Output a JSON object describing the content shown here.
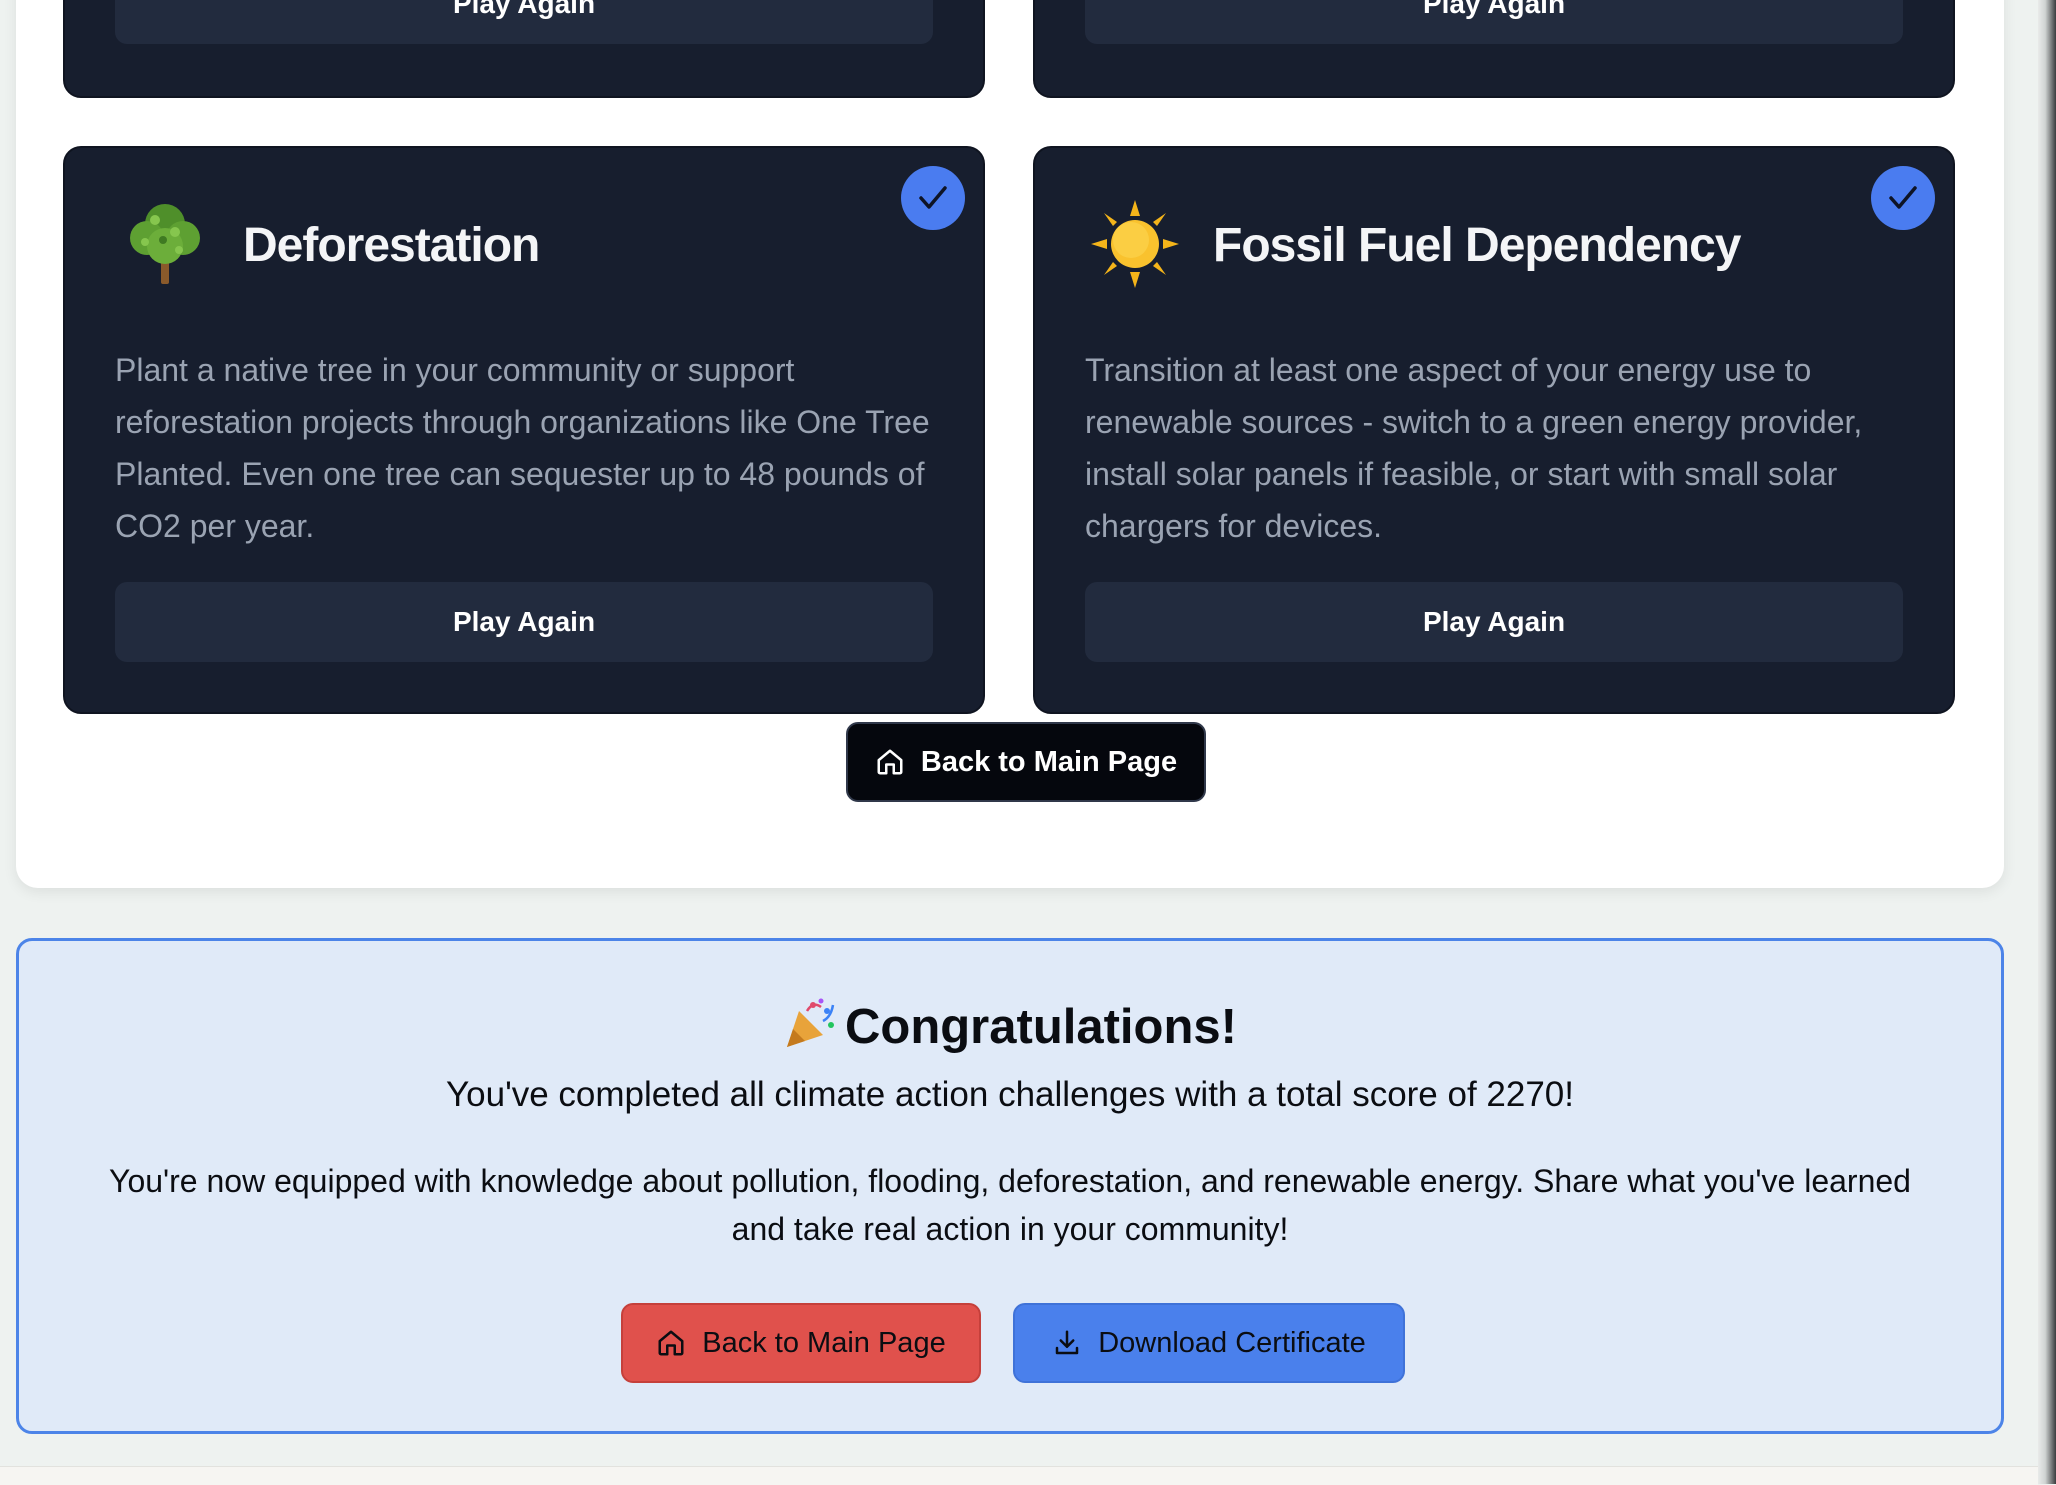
{
  "top_cards": [
    {
      "play_label": "Play Again"
    },
    {
      "play_label": "Play Again"
    }
  ],
  "cards": [
    {
      "icon": "tree-icon",
      "title": "Deforestation",
      "description": "Plant a native tree in your community or support reforestation projects through organizations like One Tree Planted. Even one tree can sequester up to 48 pounds of CO2 per year.",
      "play_label": "Play Again",
      "completed": true
    },
    {
      "icon": "sun-icon",
      "title": "Fossil Fuel Dependency",
      "description": "Transition at least one aspect of your energy use to renewable sources - switch to a green energy provider, install solar panels if feasible, or start with small solar chargers for devices.",
      "play_label": "Play Again",
      "completed": true
    }
  ],
  "back_main_label": "Back to Main Page",
  "congrats": {
    "icon": "party-popper-icon",
    "heading": "Congratulations!",
    "score_line": "You've completed all climate action challenges with a total score of 2270!",
    "info_line": "You're now equipped with knowledge about pollution, flooding, deforestation, and renewable energy. Share what you've learned and take real action in your community!",
    "back_label": "Back to Main Page",
    "download_label": "Download Certificate"
  },
  "colors": {
    "card_bg": "#171e2e",
    "accent_blue": "#4a7cf0",
    "danger_red": "#e0514c",
    "congrats_bg": "#e0eaf8"
  }
}
